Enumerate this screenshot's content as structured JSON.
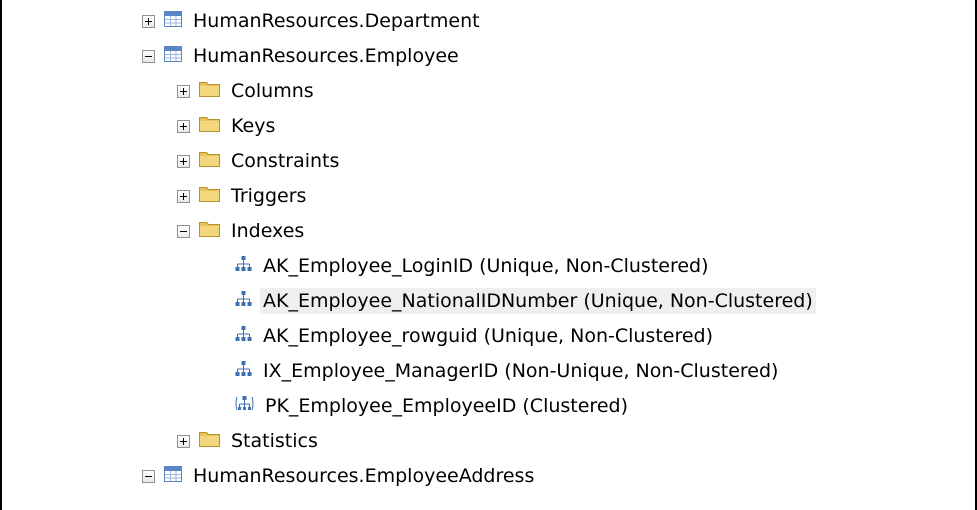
{
  "tree": {
    "nodes": [
      {
        "label": "HumanResources.Department",
        "icon": "table-icon",
        "toggle": "plus"
      },
      {
        "label": "HumanResources.Employee",
        "icon": "table-icon",
        "toggle": "minus"
      },
      {
        "label": "Columns",
        "icon": "folder-icon",
        "toggle": "plus"
      },
      {
        "label": "Keys",
        "icon": "folder-icon",
        "toggle": "plus"
      },
      {
        "label": "Constraints",
        "icon": "folder-icon",
        "toggle": "plus"
      },
      {
        "label": "Triggers",
        "icon": "folder-icon",
        "toggle": "plus"
      },
      {
        "label": "Indexes",
        "icon": "folder-icon",
        "toggle": "minus"
      },
      {
        "label": "AK_Employee_LoginID (Unique, Non-Clustered)",
        "icon": "nonclustered-index-icon"
      },
      {
        "label": "AK_Employee_NationalIDNumber (Unique, Non-Clustered)",
        "icon": "nonclustered-index-icon",
        "selected": true
      },
      {
        "label": "AK_Employee_rowguid (Unique, Non-Clustered)",
        "icon": "nonclustered-index-icon"
      },
      {
        "label": "IX_Employee_ManagerID (Non-Unique, Non-Clustered)",
        "icon": "nonclustered-index-icon"
      },
      {
        "label": "PK_Employee_EmployeeID (Clustered)",
        "icon": "clustered-index-icon"
      },
      {
        "label": "Statistics",
        "icon": "folder-icon",
        "toggle": "plus"
      },
      {
        "label": "HumanResources.EmployeeAddress",
        "icon": "table-icon",
        "toggle": "minus"
      }
    ]
  },
  "colors": {
    "table_icon": "#5b86c4",
    "folder": "#e8c35a",
    "index_icon": "#3d6fb3",
    "selection": "#efefef"
  }
}
